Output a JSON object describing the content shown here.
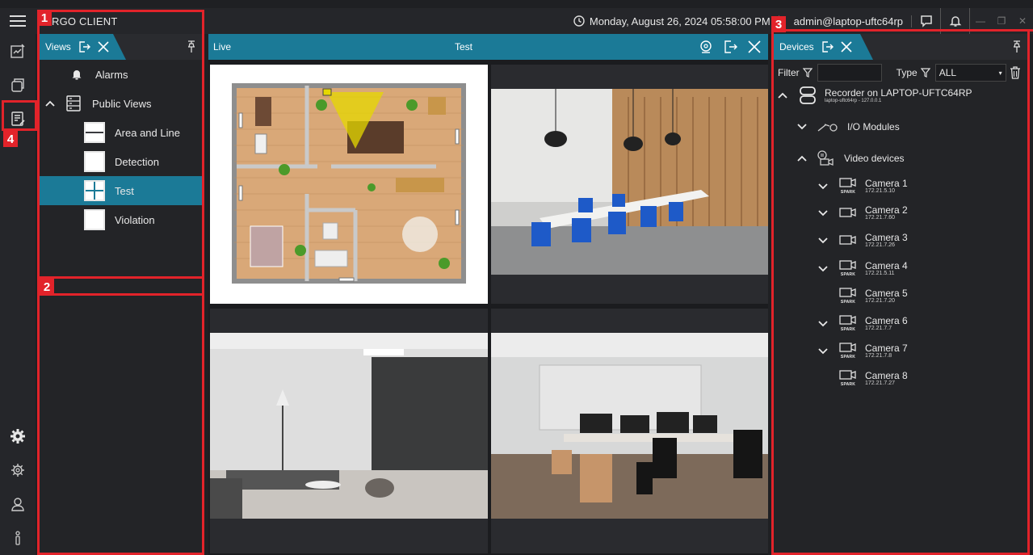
{
  "app": {
    "title": "RGO CLIENT"
  },
  "titlebar": {
    "datetime": "Monday, August 26, 2024 05:58:00 PM",
    "user": "admin@laptop-uftc64rp"
  },
  "callouts": {
    "one": "1",
    "two": "2",
    "three": "3",
    "four": "4"
  },
  "views": {
    "tab_label": "Views",
    "items": [
      {
        "label": "Alarms"
      },
      {
        "label": "Public Views"
      },
      {
        "label": "Area and Line"
      },
      {
        "label": "Detection"
      },
      {
        "label": "Test"
      },
      {
        "label": "Violation"
      }
    ]
  },
  "live": {
    "tab_label": "Live",
    "view_name": "Test"
  },
  "devices": {
    "tab_label": "Devices",
    "filter_label": "Filter",
    "type_label": "Type",
    "type_value": "ALL",
    "recorder_name": "Recorder on LAPTOP-UFTC64RP",
    "recorder_sub": "laptop-uftc64rp - 127.0.0.1",
    "io_modules": "I/O Modules",
    "video_devices": "Video devices",
    "spark": "SPARK",
    "cameras": [
      {
        "name": "Camera 1",
        "ip": "172.21.5.10"
      },
      {
        "name": "Camera 2",
        "ip": "172.21.7.60"
      },
      {
        "name": "Camera 3",
        "ip": "172.21.7.26"
      },
      {
        "name": "Camera 4",
        "ip": "172.21.5.11"
      },
      {
        "name": "Camera 5",
        "ip": "172.21.7.20"
      },
      {
        "name": "Camera 6",
        "ip": "172.21.7.7"
      },
      {
        "name": "Camera 7",
        "ip": "172.21.7.8"
      },
      {
        "name": "Camera 8",
        "ip": "172.21.7.27"
      }
    ]
  },
  "colors": {
    "accent": "#1b7a97",
    "callout": "#e2232a",
    "background": "#1f2023"
  }
}
